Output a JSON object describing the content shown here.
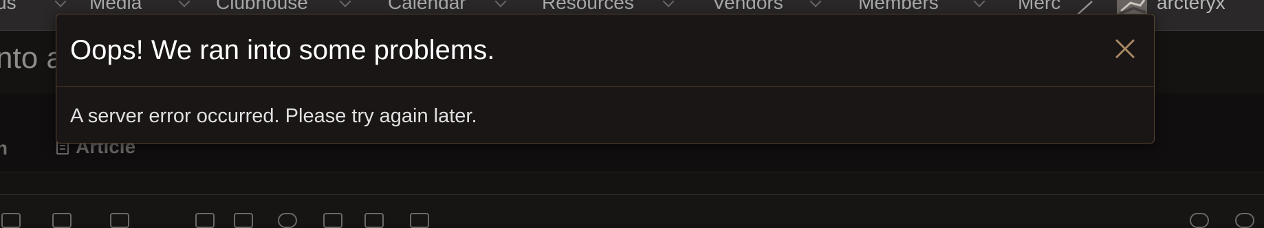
{
  "nav": {
    "items": [
      {
        "label": "us"
      },
      {
        "label": "Media"
      },
      {
        "label": "Clubhouse"
      },
      {
        "label": "Calendar"
      },
      {
        "label": "Resources"
      },
      {
        "label": "Vendors"
      },
      {
        "label": "Members"
      },
      {
        "label": "Merc"
      }
    ],
    "username": "arcteryx"
  },
  "page": {
    "title_fragment": "nto a",
    "tab_fragment": "n",
    "tab_article": "Article"
  },
  "modal": {
    "title": "Oops! We ran into some problems.",
    "message": "A server error occurred. Please try again later.",
    "accent_color": "#a88a62"
  }
}
